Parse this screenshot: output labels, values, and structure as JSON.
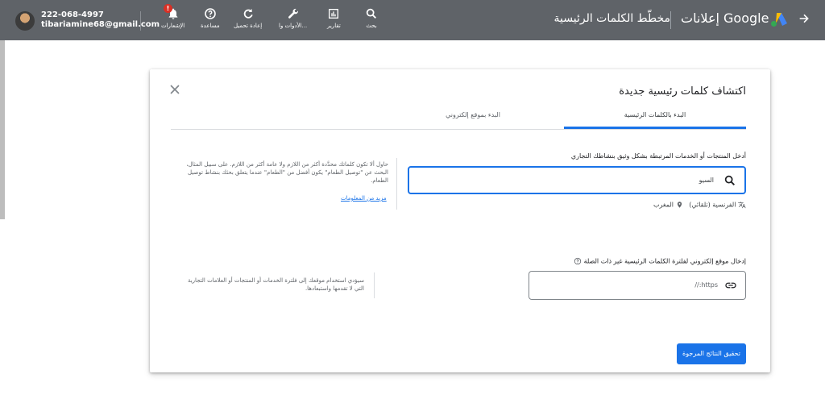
{
  "account": {
    "phone": "222-068-4997",
    "email": "tibariamine68@gmail.com"
  },
  "toolbar": {
    "notifications_label": "الإشعارات",
    "notifications_badge": "!",
    "help_label": "مساعدة",
    "reload_label": "إعادة تحميل",
    "tools_label": "الأدوات وا...",
    "reports_label": "تقارير",
    "search_label": "بحث"
  },
  "header": {
    "page_title": "مخطّط الكلمات الرئيسية",
    "brand": "إعلانات Google"
  },
  "dialog": {
    "title": "اكتشاف كلمات رئيسية جديدة",
    "tabs": [
      {
        "label": "البدء بالكلمات الرئيسية",
        "active": true
      },
      {
        "label": "البدء بموقع إلكتروني",
        "active": false
      }
    ],
    "keywords_label": "أدخل المنتجات أو الخدمات المرتبطة بشكل وثيق بنشاطك التجاري",
    "keywords_value": "السيو",
    "language": "الفرنسية (تلقائي)",
    "location": "المغرب",
    "tip_text": "حاول ألا تكون كلماتك محدَّدة أكثر من اللازم ولا عامة أكثر من اللازم. على سبيل المثال، البحث عن \"توصيل الطعام\" يكون أفضل من \"الطعام\" عندما يتعلق بحثك بنشاط توصيل الطعام.",
    "tip_link": "مزيد من المعلومات",
    "website_label": "إدخال موقع إلكتروني لفلترة الكلمات الرئيسية غير ذات الصلة",
    "website_placeholder": "https://",
    "website_tip": "سيؤدي استخدام موقعك إلى فلترة الخدمات أو المنتجات أو العلامات التجارية التي لا تقدمها واستبعادها.",
    "submit_label": "تحقيق النتائج المرجوة"
  },
  "colors": {
    "topbar": "#5f6368",
    "accent": "#1a73e8",
    "badge": "#d93025"
  }
}
